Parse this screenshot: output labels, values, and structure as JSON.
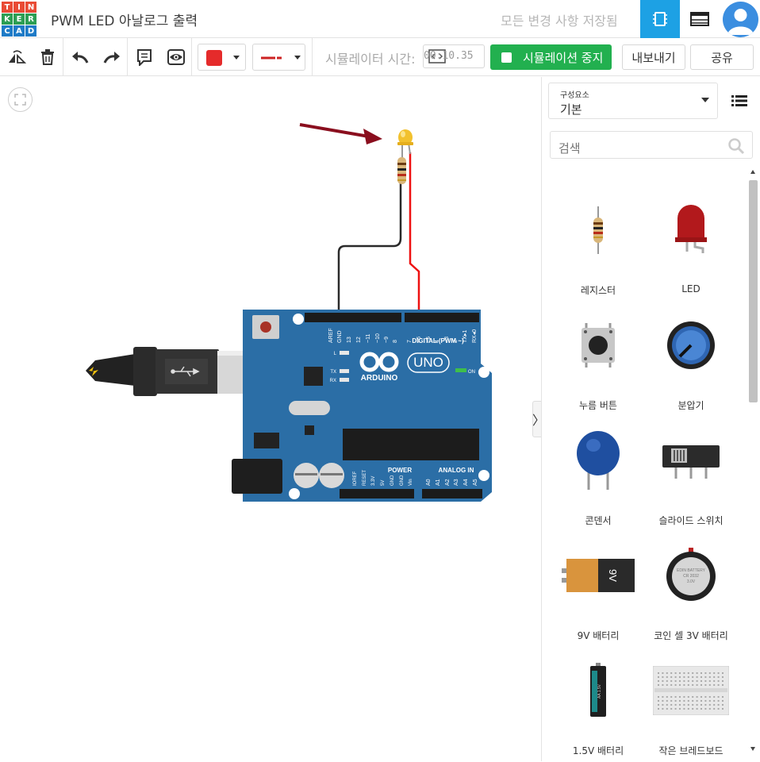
{
  "app": {
    "logo_letters": [
      "T",
      "I",
      "N",
      "K",
      "E",
      "R",
      "C",
      "A",
      "D"
    ],
    "logo_colors": [
      "#e94b35",
      "#e94b35",
      "#e94b35",
      "#2c9e53",
      "#2c9e53",
      "#2c9e53",
      "#1e7bc7",
      "#1e7bc7",
      "#1e7bc7"
    ],
    "title": "PWM LED 아날로그 출력",
    "save_status": "모든 변경 사항 저장됨"
  },
  "toolbar": {
    "sim_time_label": "시뮬레이터 시간: ",
    "sim_time_value": "00:10.35",
    "stop_label": "시뮬레이션 중지",
    "export_label": "내보내기",
    "share_label": "공유",
    "color_value": "#e52b2b"
  },
  "panel": {
    "dropdown_label": "구성요소",
    "dropdown_value": "기본",
    "search_placeholder": "검색",
    "components": [
      {
        "id": "resistor",
        "label": "레지스터"
      },
      {
        "id": "led",
        "label": "LED"
      },
      {
        "id": "pushbutton",
        "label": "누름 버튼"
      },
      {
        "id": "potentiometer",
        "label": "분압기"
      },
      {
        "id": "capacitor",
        "label": "콘덴서"
      },
      {
        "id": "slideswitch",
        "label": "슬라이드 스위치"
      },
      {
        "id": "battery9v",
        "label": "9V 배터리"
      },
      {
        "id": "coincell",
        "label": "코인 셀 3V 배터리"
      },
      {
        "id": "battery15v",
        "label": "1.5V 배터리"
      },
      {
        "id": "breadboard",
        "label": "작은 브레드보드"
      }
    ]
  },
  "board": {
    "brand": "ARDUINO",
    "model": "UNO",
    "digital_label": "DIGITAL (PWM ~)",
    "power_label": "POWER",
    "analog_label": "ANALOG IN",
    "on_label": "ON",
    "digital_pins": [
      "AREF",
      "GND",
      "13",
      "12",
      "~11",
      "~10",
      "~9",
      "8",
      "7",
      "~6",
      "~5",
      "4",
      "~3",
      "2",
      "TX▸1",
      "RX◂0"
    ],
    "power_pins": [
      "IOREF",
      "RESET",
      "3.3V",
      "5V",
      "GND",
      "GND",
      "Vin"
    ],
    "analog_pins": [
      "A0",
      "A1",
      "A2",
      "A3",
      "A4",
      "A5"
    ],
    "led_labels": [
      "L",
      "TX",
      "RX"
    ],
    "battery_9v": "9V",
    "coin_text": [
      "EDIN BATTERY",
      "CR 2032",
      "3.0V"
    ],
    "aa_text": "AA 1.5V"
  }
}
